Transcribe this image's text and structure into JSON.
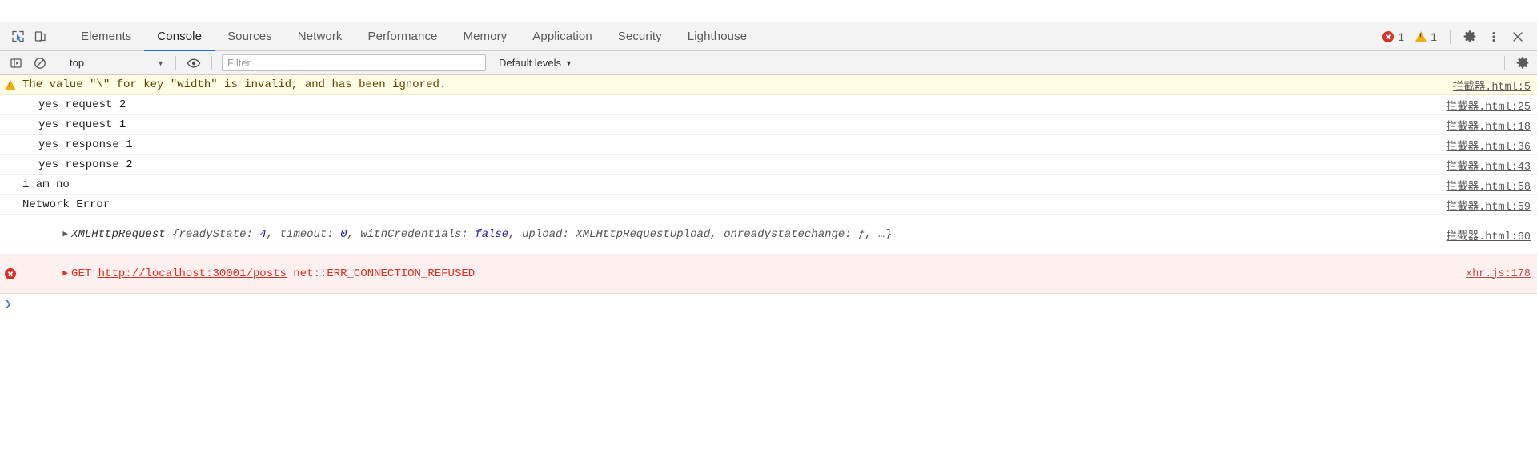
{
  "toolbar": {
    "icons": [
      {
        "name": "inspect-element-icon",
        "label": "Inspect element"
      },
      {
        "name": "device-toolbar-icon",
        "label": "Toggle device toolbar"
      }
    ],
    "tabs": [
      {
        "label": "Elements",
        "active": false
      },
      {
        "label": "Console",
        "active": true
      },
      {
        "label": "Sources",
        "active": false
      },
      {
        "label": "Network",
        "active": false
      },
      {
        "label": "Performance",
        "active": false
      },
      {
        "label": "Memory",
        "active": false
      },
      {
        "label": "Application",
        "active": false
      },
      {
        "label": "Security",
        "active": false
      },
      {
        "label": "Lighthouse",
        "active": false
      }
    ],
    "error_count": "1",
    "warning_count": "1",
    "settings_icon": "gear-icon",
    "more_icon": "kebab-menu-icon",
    "close_icon": "close-icon"
  },
  "console_toolbar": {
    "execute_icon": "console-sidebar-icon",
    "clear_icon": "clear-console-icon",
    "context": "top",
    "context_caret": "▼",
    "eye_icon": "live-expression-eye-icon",
    "filter_placeholder": "Filter",
    "filter_value": "",
    "levels_label": "Default levels",
    "levels_caret": "▼",
    "settings_icon": "console-settings-gear-icon"
  },
  "messages": [
    {
      "type": "warning",
      "icon": "warning-triangle-icon",
      "text": "The value \"\\\" for key \"width\" is invalid, and has been ignored.",
      "source": "拦截器.html:5",
      "indented": false
    },
    {
      "type": "log",
      "icon": "",
      "text": "yes request 2",
      "source": "拦截器.html:25",
      "indented": true
    },
    {
      "type": "log",
      "icon": "",
      "text": "yes request 1",
      "source": "拦截器.html:18",
      "indented": true
    },
    {
      "type": "log",
      "icon": "",
      "text": "yes response 1",
      "source": "拦截器.html:36",
      "indented": true
    },
    {
      "type": "log",
      "icon": "",
      "text": "yes response 2",
      "source": "拦截器.html:43",
      "indented": true
    },
    {
      "type": "log",
      "icon": "",
      "text": "i am no",
      "source": "拦截器.html:58",
      "indented": false
    },
    {
      "type": "log",
      "icon": "",
      "text": "Network Error",
      "source": "拦截器.html:59",
      "indented": false
    }
  ],
  "object_message": {
    "disclosure": "▶",
    "name": "XMLHttpRequest",
    "open_brace": " {",
    "props": [
      {
        "key": "readyState: ",
        "value": "4",
        "value_type": "num",
        "sep": ", "
      },
      {
        "key": "timeout: ",
        "value": "0",
        "value_type": "num",
        "sep": ", "
      },
      {
        "key": "withCredentials: ",
        "value": "false",
        "value_type": "bool",
        "sep": ", "
      },
      {
        "key": "upload: ",
        "value": "XMLHttpRequestUpload",
        "value_type": "plain",
        "sep": ", "
      },
      {
        "key": "onreadystatechange: ",
        "value": "ƒ",
        "value_type": "plain",
        "sep": ", "
      }
    ],
    "ellipsis": "…}",
    "source": "拦截器.html:60"
  },
  "error_message": {
    "icon": "error-circle-icon",
    "disclosure": "▶",
    "method": "GET ",
    "url": "http://localhost:30001/posts",
    "status": " net::ERR_CONNECTION_REFUSED",
    "source": "xhr.js:178"
  },
  "prompt": {
    "caret": "❯"
  },
  "colors": {
    "accent": "#1a73e8",
    "error": "#d93025",
    "warning": "#f0ad15",
    "warning_bg": "#fffbe5",
    "error_bg": "#fff0f0",
    "toolbar_bg": "#f3f3f3"
  }
}
